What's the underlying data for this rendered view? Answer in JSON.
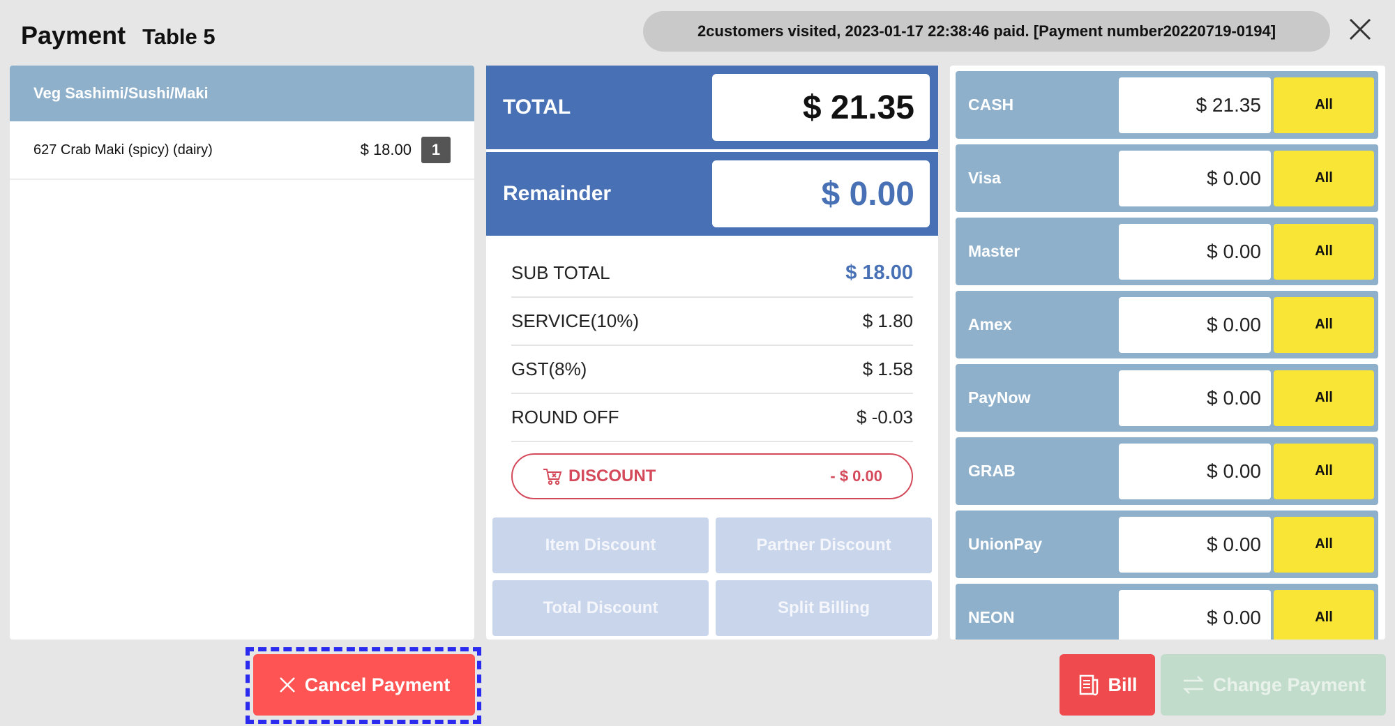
{
  "header": {
    "title": "Payment",
    "table": "Table 5",
    "notice": "2customers visited, 2023-01-17 22:38:46 paid. [Payment number20220719-0194]"
  },
  "order": {
    "category": "Veg Sashimi/Sushi/Maki",
    "items": [
      {
        "name": "627 Crab Maki (spicy) (dairy)",
        "price": "$ 18.00",
        "qty": "1"
      }
    ]
  },
  "totals": {
    "total_label": "TOTAL",
    "total_value": "$ 21.35",
    "remainder_label": "Remainder",
    "remainder_value": "$ 0.00"
  },
  "summary": [
    {
      "label": "SUB TOTAL",
      "value": "$ 18.00"
    },
    {
      "label": "SERVICE(10%)",
      "value": "$ 1.80"
    },
    {
      "label": "GST(8%)",
      "value": "$ 1.58"
    },
    {
      "label": "ROUND OFF",
      "value": "$ -0.03"
    }
  ],
  "discount": {
    "label": "DISCOUNT",
    "value": "- $ 0.00"
  },
  "discount_buttons": [
    "Item Discount",
    "Partner Discount",
    "Total Discount",
    "Split Billing"
  ],
  "payments": [
    {
      "name": "CASH",
      "value": "$ 21.35",
      "all": "All"
    },
    {
      "name": "Visa",
      "value": "$ 0.00",
      "all": "All"
    },
    {
      "name": "Master",
      "value": "$ 0.00",
      "all": "All"
    },
    {
      "name": "Amex",
      "value": "$ 0.00",
      "all": "All"
    },
    {
      "name": "PayNow",
      "value": "$ 0.00",
      "all": "All"
    },
    {
      "name": "GRAB",
      "value": "$ 0.00",
      "all": "All"
    },
    {
      "name": "UnionPay",
      "value": "$ 0.00",
      "all": "All"
    },
    {
      "name": "NEON",
      "value": "$ 0.00",
      "all": "All"
    }
  ],
  "actions": {
    "cancel": "Cancel Payment",
    "bill": "Bill",
    "change": "Change Payment"
  },
  "colors": {
    "accent_blue": "#4870b5",
    "category_blue": "#8fb0cb",
    "all_yellow": "#f8e535",
    "cancel_red": "#ff5454",
    "highlight_dashed": "#2b2bf0"
  }
}
